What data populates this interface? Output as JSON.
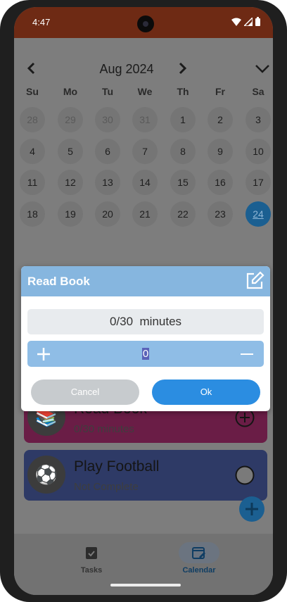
{
  "status": {
    "time": "4:47"
  },
  "calendar": {
    "month_label": "Aug 2024",
    "weekdays": [
      "Su",
      "Mo",
      "Tu",
      "We",
      "Th",
      "Fr",
      "Sa"
    ],
    "rows": [
      [
        "28",
        "29",
        "30",
        "31",
        "1",
        "2",
        "3"
      ],
      [
        "4",
        "5",
        "6",
        "7",
        "8",
        "9",
        "10"
      ],
      [
        "11",
        "12",
        "13",
        "14",
        "15",
        "16",
        "17"
      ],
      [
        "18",
        "19",
        "20",
        "21",
        "22",
        "23",
        "24"
      ]
    ],
    "today": "24"
  },
  "tasks": [
    {
      "title": "Read Book",
      "subtitle": "0/30 minutes",
      "icon": "books-icon",
      "emoji": "📚",
      "color": "#6a1d46"
    },
    {
      "title": "Play Football",
      "subtitle": "Not Complete",
      "icon": "soccer-ball-icon",
      "emoji": "⚽",
      "color": "#2e3a66"
    }
  ],
  "dialog": {
    "title": "Read Book",
    "progress_value": "0/30",
    "progress_unit": "minutes",
    "input_value": "0",
    "cancel_label": "Cancel",
    "ok_label": "Ok"
  },
  "bottom_nav": {
    "tasks_label": "Tasks",
    "calendar_label": "Calendar"
  },
  "colors": {
    "accent": "#2b8de1",
    "dialog_header": "#86b6df",
    "status_bar": "#6e2a14"
  }
}
